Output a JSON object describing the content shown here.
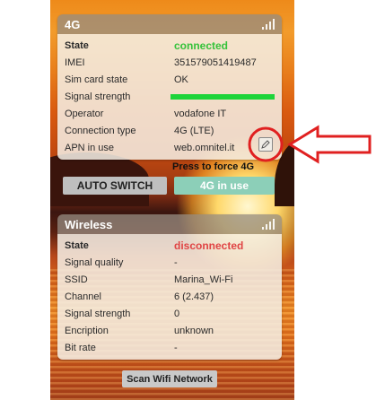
{
  "cellular": {
    "title": "4G",
    "rows": [
      {
        "label": "State",
        "value": "connected"
      },
      {
        "label": "IMEI",
        "value": "351579051419487"
      },
      {
        "label": "Sim card state",
        "value": "OK"
      },
      {
        "label": "Signal strength",
        "value": ""
      },
      {
        "label": "Operator",
        "value": "vodafone IT"
      },
      {
        "label": "Connection type",
        "value": "4G (LTE)"
      },
      {
        "label": "APN in use",
        "value": "web.omnitel.it"
      }
    ],
    "signal_fraction": 1.0,
    "force_hint": "Press to force 4G",
    "auto_switch_label": "AUTO SWITCH",
    "in_use_label": "4G in use"
  },
  "wireless": {
    "title": "Wireless",
    "rows": [
      {
        "label": "State",
        "value": "disconnected"
      },
      {
        "label": "Signal quality",
        "value": "-"
      },
      {
        "label": "SSID",
        "value": "Marina_Wi-Fi"
      },
      {
        "label": "Channel",
        "value": "6 (2.437)"
      },
      {
        "label": "Signal strength",
        "value": "0"
      },
      {
        "label": "Encription",
        "value": "unknown"
      },
      {
        "label": "Bit rate",
        "value": "-"
      }
    ],
    "scan_label": "Scan Wifi Network"
  },
  "colors": {
    "connected": "#35c23a",
    "disconnected": "#e04444",
    "signal_bar": "#1ed43a",
    "annotation": "#e02020"
  },
  "icons": [
    "signal-bars-icon",
    "edit-icon",
    "arrow-left-icon"
  ]
}
